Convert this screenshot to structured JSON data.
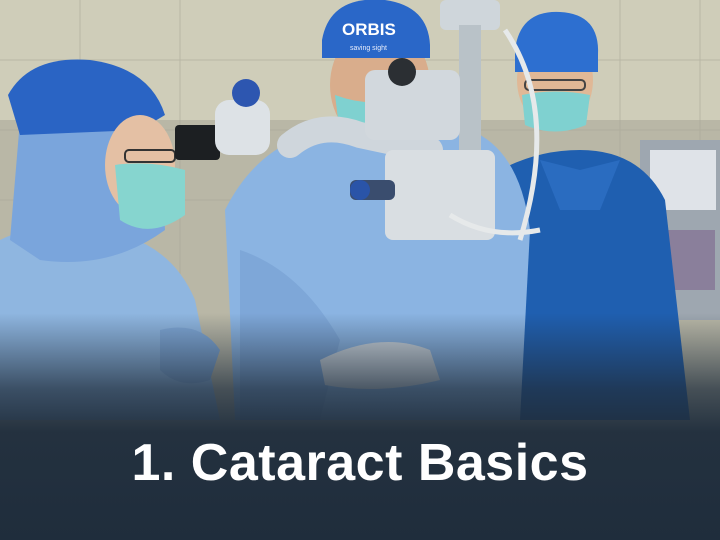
{
  "card": {
    "title": "1. Cataract Basics",
    "background_color": "#1f2d3c",
    "title_color": "#ffffff"
  },
  "photo": {
    "cap_logo_text": "ORBIS",
    "cap_tagline_text": "saving sight"
  },
  "icons": [
    "surgical-microscope-icon"
  ]
}
